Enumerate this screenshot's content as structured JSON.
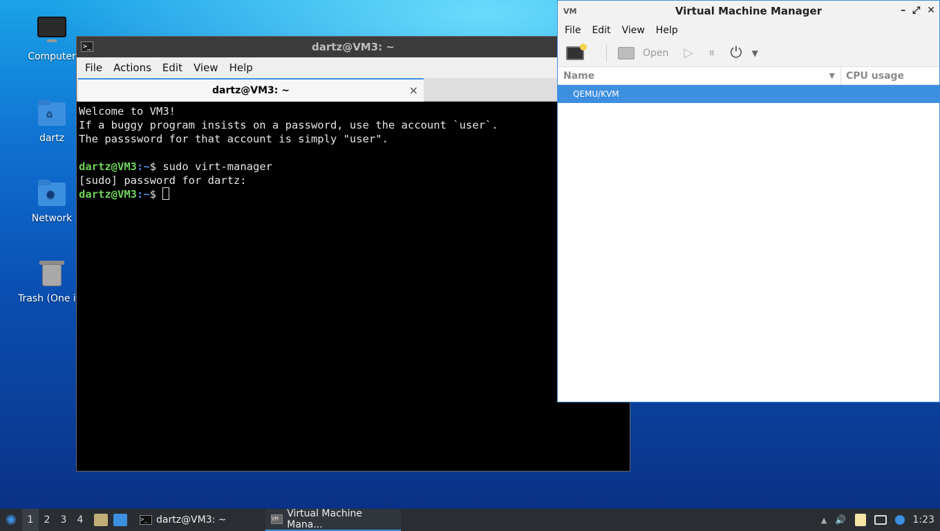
{
  "desktop": {
    "icons": [
      {
        "label": "Computer"
      },
      {
        "label": "dartz"
      },
      {
        "label": "Network"
      },
      {
        "label": "Trash (One ite"
      }
    ]
  },
  "terminal": {
    "title": "dartz@VM3: ~",
    "menu": [
      "File",
      "Actions",
      "Edit",
      "View",
      "Help"
    ],
    "tab_label": "dartz@VM3: ~",
    "tab_close": "×",
    "lines": [
      "Welcome to VM3!",
      "If a buggy program insists on a password, use the account `user`.",
      "The passsword for that account is simply \"user\".",
      ""
    ],
    "prompt_user": "dartz@VM3",
    "prompt_path": ":~",
    "prompt_symbol": "$ ",
    "command": "sudo virt-manager",
    "sudo_line": "[sudo] password for dartz:"
  },
  "vmm": {
    "title": "Virtual Machine Manager",
    "app_icon": "VM",
    "wm_minimize": "–",
    "wm_maximize": "⤢",
    "wm_close": "✕",
    "menu": [
      "File",
      "Edit",
      "View",
      "Help"
    ],
    "toolbar": {
      "open_label": "Open",
      "play_icon": "▷",
      "pause_icon": "⏸",
      "power_icon": "⏻",
      "dropdown_icon": "▼"
    },
    "columns": {
      "name": "Name",
      "cpu": "CPU usage",
      "sort_icon": "▼"
    },
    "rows": [
      "QEMU/KVM"
    ]
  },
  "taskbar": {
    "start_icon": "✺",
    "workspaces": [
      "1",
      "2",
      "3",
      "4"
    ],
    "tasks": [
      {
        "label": "dartz@VM3: ~",
        "icon": ">_"
      },
      {
        "label": "Virtual Machine Mana...",
        "icon": "VM"
      }
    ],
    "tray": {
      "up_icon": "▲",
      "volume_icon": "🔊",
      "clock": "1:23"
    }
  }
}
